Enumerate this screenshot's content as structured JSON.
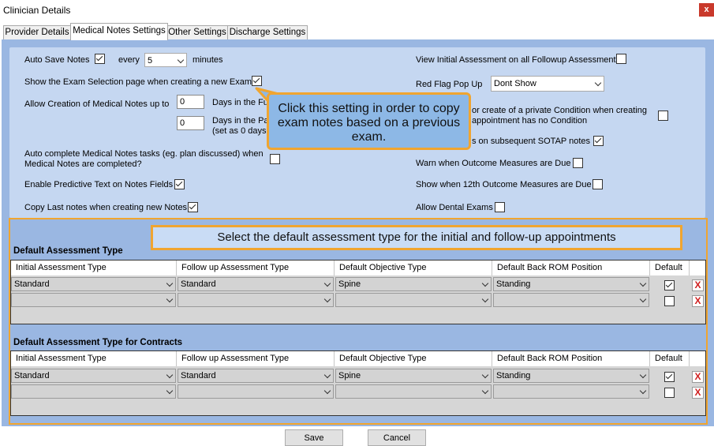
{
  "window": {
    "title": "Clinician Details",
    "close_label": "x"
  },
  "tabs": [
    {
      "label": "Provider Details"
    },
    {
      "label": "Medical Notes Settings"
    },
    {
      "label": "Other Settings"
    },
    {
      "label": "Discharge Settings"
    }
  ],
  "settings": {
    "auto_save": {
      "label": "Auto Save Notes",
      "checked": true,
      "every_label": "every",
      "minutes_value": "5",
      "minutes_label": "minutes"
    },
    "exam_selection": {
      "label": "Show the Exam Selection page when creating a new Exam",
      "checked": true
    },
    "creation": {
      "label": "Allow Creation of Medical Notes up to",
      "future_value": "0",
      "future_label": "Days in the Fu",
      "past_value": "0",
      "past_label": "Days in the Pa",
      "past_note": "(set as 0 days"
    },
    "auto_complete": {
      "label_line1": "Auto complete Medical Notes tasks (eg. plan discussed) when",
      "label_line2": "Medical Notes are completed?",
      "checked": false
    },
    "predictive": {
      "label": "Enable Predictive Text on Notes Fields",
      "checked": true
    },
    "copy_last": {
      "label": "Copy Last notes when creating new Notes",
      "checked": true
    },
    "view_initial": {
      "label": "View Initial Assessment on all Followup Assessments",
      "checked": false
    },
    "red_flag": {
      "label": "Red Flag Pop Up",
      "value": "Dont Show"
    },
    "private_condition": {
      "label_line1": "or create of a private Condition when creating",
      "label_line2": "appointment has no Condition",
      "checked": false
    },
    "sotap": {
      "label": "s on subsequent SOTAP notes",
      "checked": true
    },
    "warn_outcome": {
      "label": "Warn when Outcome Measures are Due",
      "checked": false
    },
    "show_12th": {
      "label": "Show when 12th Outcome Measures are Due",
      "checked": false
    },
    "dental": {
      "label": "Allow Dental Exams",
      "checked": false
    }
  },
  "callouts": {
    "exam_copy": "Click this setting in order to copy exam notes based on a previous exam.",
    "assessment_type": "Select the default assessment type for the initial and follow-up appointments"
  },
  "grids": {
    "columns": [
      "Initial Assessment Type",
      "Follow up Assessment Type",
      "Default Objective Type",
      "Default Back ROM Position",
      "Default"
    ],
    "default_assessment": {
      "title": "Default Assessment Type",
      "rows": [
        {
          "initial": "Standard",
          "followup": "Standard",
          "objective": "Spine",
          "rom": "Standing",
          "default": true
        },
        {
          "initial": "",
          "followup": "",
          "objective": "",
          "rom": "",
          "default": false
        }
      ]
    },
    "contracts": {
      "title": "Default Assessment Type for Contracts",
      "rows": [
        {
          "initial": "Standard",
          "followup": "Standard",
          "objective": "Spine",
          "rom": "Standing",
          "default": true
        },
        {
          "initial": "",
          "followup": "",
          "objective": "",
          "rom": "",
          "default": false
        }
      ]
    },
    "delete_label": "X"
  },
  "buttons": {
    "save": "Save",
    "cancel": "Cancel"
  },
  "colors": {
    "panel": "#9ab7e2",
    "settings_area": "#c5d7f1",
    "callout_border": "#f0a530",
    "callout_fill": "#8db8e6",
    "delete_red": "#d02020"
  }
}
